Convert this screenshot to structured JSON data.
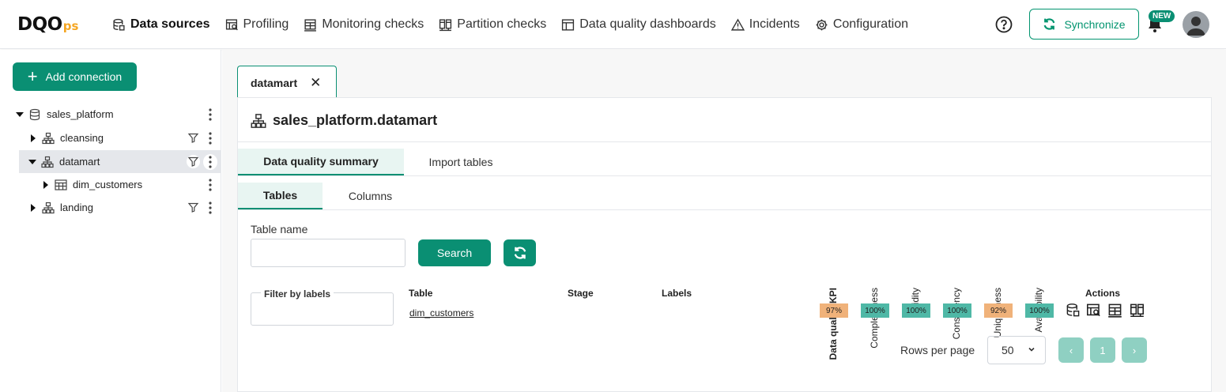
{
  "app": {
    "logo_main": "DQO",
    "logo_sub": "ps"
  },
  "nav": {
    "items": [
      {
        "label": "Data sources"
      },
      {
        "label": "Profiling"
      },
      {
        "label": "Monitoring checks"
      },
      {
        "label": "Partition checks"
      },
      {
        "label": "Data quality dashboards"
      },
      {
        "label": "Incidents"
      },
      {
        "label": "Configuration"
      }
    ],
    "sync_label": "Synchronize",
    "new_badge": "NEW"
  },
  "sidebar": {
    "add_connection": "Add connection",
    "tree": [
      {
        "label": "sales_platform",
        "level": 0
      },
      {
        "label": "cleansing",
        "level": 1
      },
      {
        "label": "datamart",
        "level": 1
      },
      {
        "label": "dim_customers",
        "level": 2
      },
      {
        "label": "landing",
        "level": 1
      }
    ]
  },
  "main": {
    "tab_label": "datamart",
    "tab_close": "✕",
    "title": "sales_platform.datamart",
    "subtabs": {
      "summary": "Data quality summary",
      "import": "Import tables"
    },
    "view_tabs": {
      "tables": "Tables",
      "columns": "Columns"
    },
    "table_name_label": "Table name",
    "table_name_value": "",
    "search_label": "Search",
    "filter_labels_legend": "Filter by labels",
    "columns": {
      "table": "Table",
      "stage": "Stage",
      "labels": "Labels",
      "actions": "Actions"
    },
    "kpi_headers": [
      "Data quality KPI",
      "Completeness",
      "Validity",
      "Consistency",
      "Uniqueness",
      "Availability"
    ],
    "rows": [
      {
        "table": "dim_customers",
        "stage": "",
        "labels": "",
        "kpis": [
          "97%",
          "100%",
          "100%",
          "100%",
          "92%",
          "100%"
        ]
      }
    ],
    "kpi_colors": {
      "good": "#4fb8a6",
      "warn": "#f0b27a"
    },
    "pagination": {
      "rows_per_page_label": "Rows per page",
      "rows_per_page_value": "50",
      "prev": "‹",
      "page": "1",
      "next": "›"
    }
  }
}
